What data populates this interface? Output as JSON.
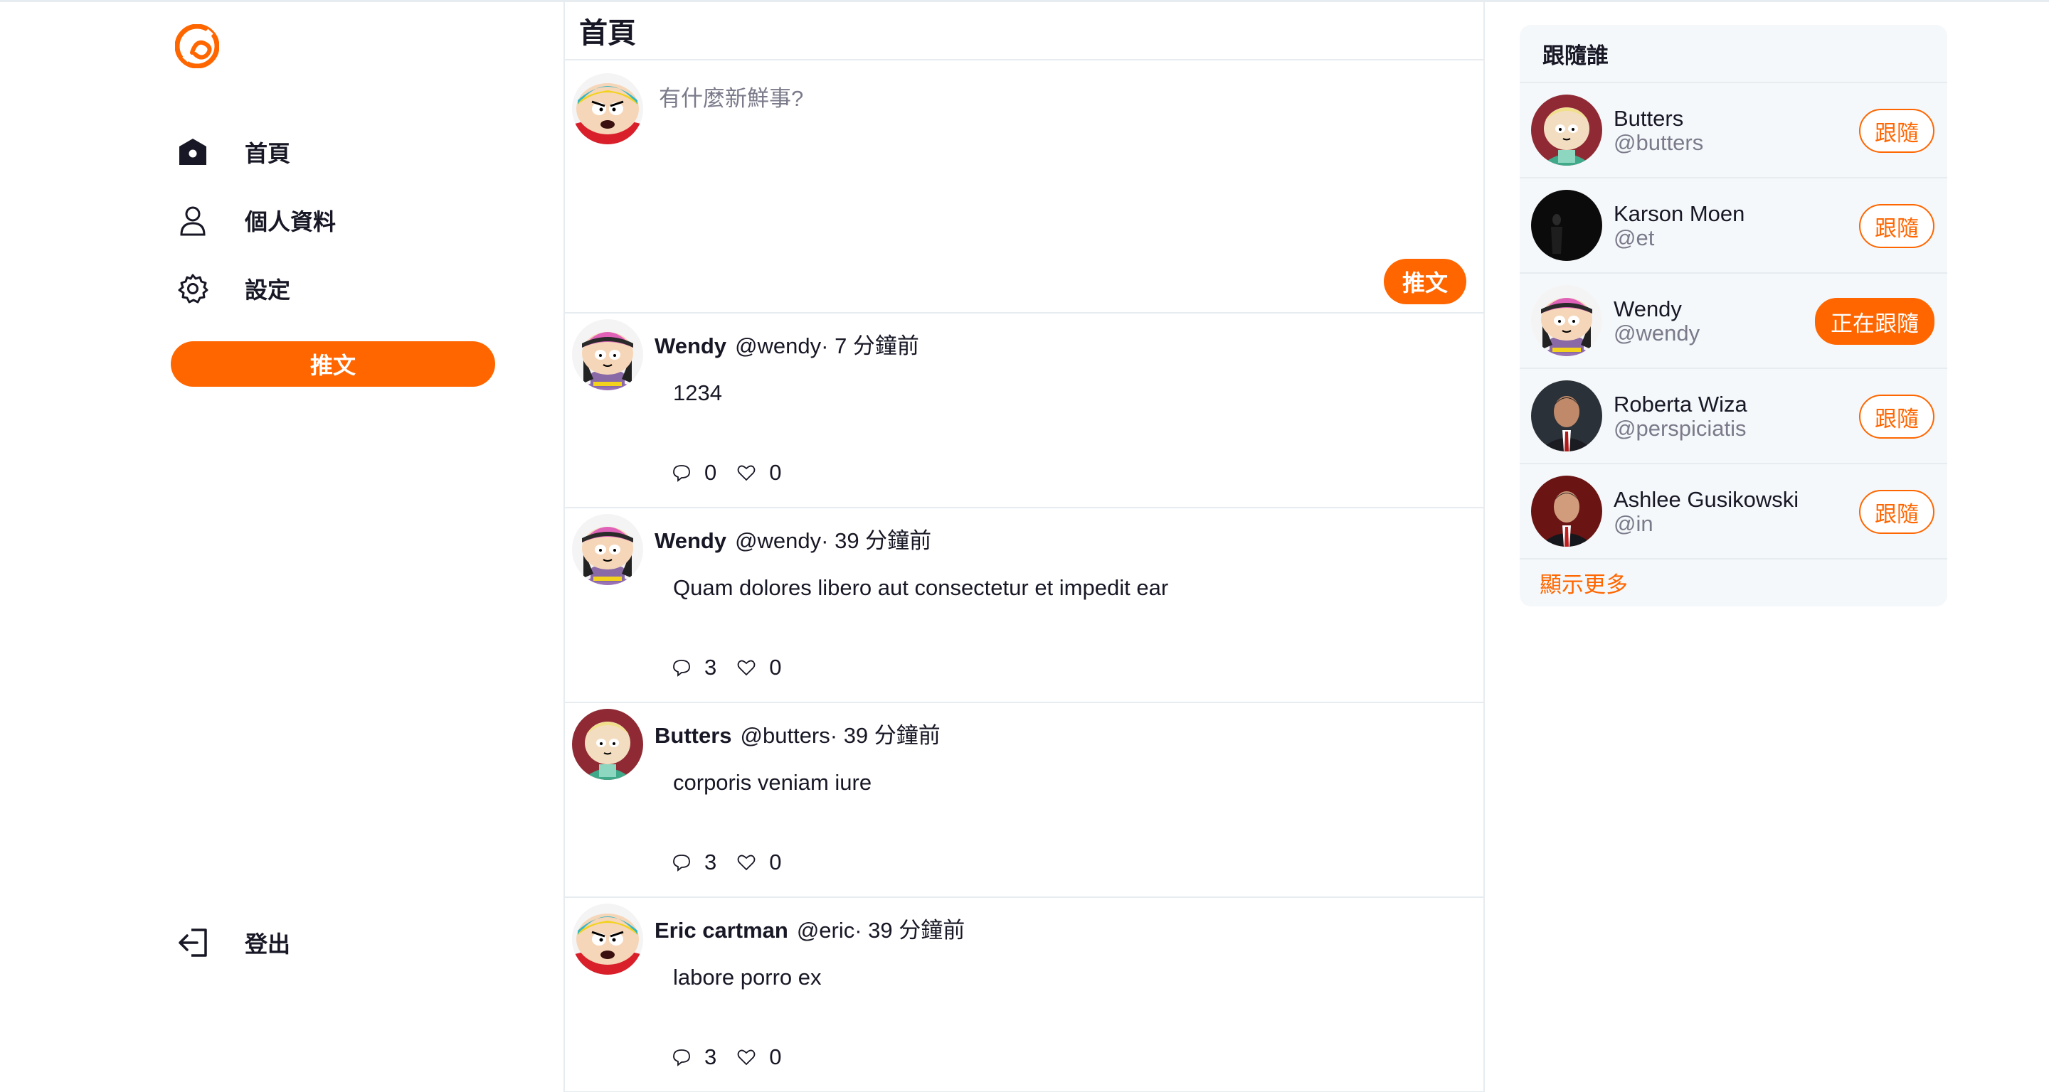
{
  "brand": {
    "accent": "#ff6600",
    "divider": "#e6ecf0"
  },
  "nav": {
    "items": [
      {
        "label": "首頁",
        "icon": "home-icon"
      },
      {
        "label": "個人資料",
        "icon": "user-icon"
      },
      {
        "label": "設定",
        "icon": "gear-icon"
      }
    ],
    "tweet_button": "推文",
    "logout": {
      "label": "登出",
      "icon": "logout-icon"
    }
  },
  "main": {
    "title": "首頁",
    "composer": {
      "placeholder": "有什麼新鮮事?",
      "button": "推文"
    },
    "tweets": [
      {
        "name": "Wendy",
        "handle": "@wendy· 7 分鐘前",
        "text": "1234",
        "replies": "0",
        "likes": "0"
      },
      {
        "name": "Wendy",
        "handle": "@wendy· 39 分鐘前",
        "text": "Quam dolores libero aut consectetur et impedit ear",
        "replies": "3",
        "likes": "0"
      },
      {
        "name": "Butters",
        "handle": "@butters· 39 分鐘前",
        "text": "corporis veniam iure",
        "replies": "3",
        "likes": "0"
      },
      {
        "name": "Eric cartman",
        "handle": "@eric· 39 分鐘前",
        "text": "labore porro ex",
        "replies": "3",
        "likes": "0"
      }
    ]
  },
  "suggestions": {
    "title": "跟隨誰",
    "users": [
      {
        "name": "Butters",
        "handle": "@butters",
        "button": "跟隨",
        "following": false
      },
      {
        "name": "Karson Moen",
        "handle": "@et",
        "button": "跟隨",
        "following": false
      },
      {
        "name": "Wendy",
        "handle": "@wendy",
        "button": "正在跟隨",
        "following": true
      },
      {
        "name": "Roberta Wiza",
        "handle": "@perspiciatis",
        "button": "跟隨",
        "following": false
      },
      {
        "name": "Ashlee Gusikowski",
        "handle": "@in",
        "button": "跟隨",
        "following": false
      }
    ],
    "show_more": "顯示更多"
  }
}
